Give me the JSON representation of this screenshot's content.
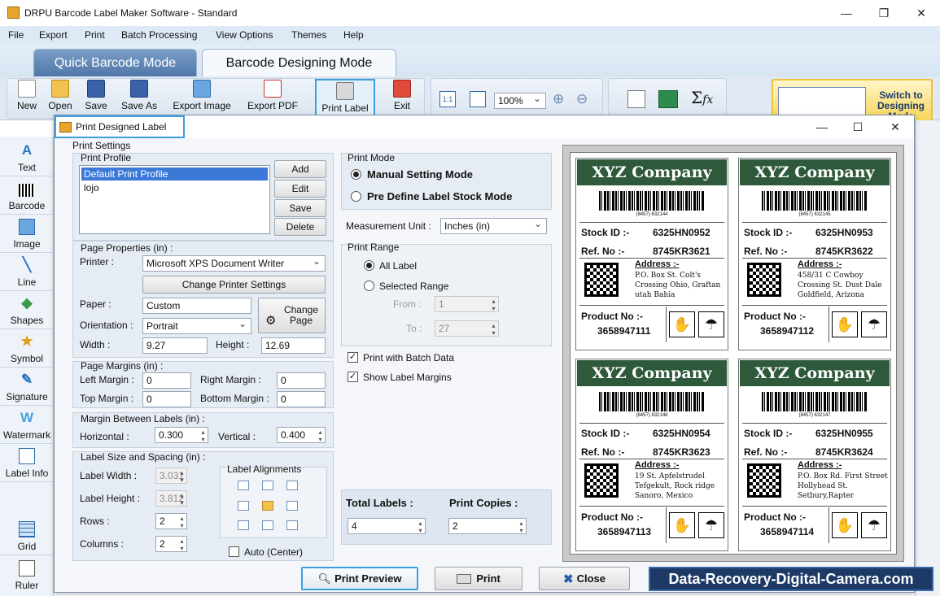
{
  "app": {
    "title": "DRPU Barcode Label Maker Software - Standard"
  },
  "menu": [
    "File",
    "Export",
    "Print",
    "Batch Processing",
    "View Options",
    "Themes",
    "Help"
  ],
  "modes": {
    "quick": "Quick Barcode Mode",
    "designing": "Barcode Designing Mode"
  },
  "toolbar": {
    "new": "New",
    "open": "Open",
    "save": "Save",
    "save_as": "Save As",
    "export_image": "Export Image",
    "export_pdf": "Export PDF",
    "print_label": "Print Label",
    "exit": "Exit",
    "zoom": "100%",
    "switch": "Switch to Designing Mode"
  },
  "leftbar": [
    "Text",
    "Barcode",
    "Image",
    "Line",
    "Shapes",
    "Symbol",
    "Signature",
    "Watermark",
    "Label Info",
    "Grid",
    "Ruler"
  ],
  "dialog": {
    "title": "Print Designed Label",
    "print_settings": "Print Settings",
    "print_profile": {
      "title": "Print Profile",
      "items": [
        "Default Print Profile",
        "lojo"
      ],
      "add": "Add",
      "edit": "Edit",
      "save": "Save",
      "delete": "Delete"
    },
    "page_props": {
      "title": "Page Properties (in) :",
      "printer_label": "Printer :",
      "printer": "Microsoft XPS Document Writer",
      "change_printer": "Change Printer Settings",
      "paper_label": "Paper :",
      "paper": "Custom",
      "orientation_label": "Orientation :",
      "orientation": "Portrait",
      "change_page": "Change Page",
      "width_label": "Width :",
      "width": "9.27",
      "height_label": "Height :",
      "height": "12.69"
    },
    "margins": {
      "title": "Page Margins (in) :",
      "left_label": "Left Margin :",
      "left": "0",
      "right_label": "Right Margin :",
      "right": "0",
      "top_label": "Top Margin :",
      "top": "0",
      "bottom_label": "Bottom Margin :",
      "bottom": "0"
    },
    "between": {
      "title": "Margin Between Labels (in) :",
      "horizontal_label": "Horizontal :",
      "horizontal": "0.300",
      "vertical_label": "Vertical :",
      "vertical": "0.400"
    },
    "size": {
      "title": "Label Size and Spacing (in) :",
      "width_label": "Label Width :",
      "width": "3.031",
      "height_label": "Label Height :",
      "height": "3.812",
      "rows_label": "Rows :",
      "rows": "2",
      "cols_label": "Columns :",
      "cols": "2",
      "alignments": "Label Alignments",
      "auto_center": "Auto (Center)"
    },
    "mode": {
      "title": "Print Mode",
      "manual": "Manual Setting Mode",
      "predefine": "Pre Define Label Stock Mode"
    },
    "unit": {
      "label": "Measurement Unit :",
      "value": "Inches (in)"
    },
    "range": {
      "title": "Print Range",
      "all": "All Label",
      "selected": "Selected Range",
      "from_label": "From :",
      "from": "1",
      "to_label": "To :",
      "to": "27"
    },
    "batch": "Print with Batch Data",
    "show_margins": "Show Label Margins",
    "totals": {
      "total_label": "Total Labels :",
      "total": "4",
      "copies_label": "Print Copies :",
      "copies": "2"
    },
    "buttons": {
      "preview": "Print Preview",
      "print": "Print",
      "close": "Close"
    }
  },
  "labels": [
    {
      "company": "XYZ Company",
      "barcode": "(8457) 632144",
      "stock_label": "Stock ID :-",
      "stock": "6325HN0952",
      "ref_label": "Ref. No :-",
      "ref": "8745KR3621",
      "addr_title": "Address :-",
      "addr": "P.O. Box St. Colt's Crossing Ohio, Graftan utah Bahia",
      "prod_label": "Product No :-",
      "prod": "3658947111"
    },
    {
      "company": "XYZ Company",
      "barcode": "(8457) 632145",
      "stock_label": "Stock ID :-",
      "stock": "6325HN0953",
      "ref_label": "Ref. No :-",
      "ref": "8745KR3622",
      "addr_title": "Address :-",
      "addr": "458/31 C Cowboy Crossing St. Dust Dale Goldfield, Arizona",
      "prod_label": "Product No :-",
      "prod": "3658947112"
    },
    {
      "company": "XYZ Company",
      "barcode": "(8457) 632146",
      "stock_label": "Stock ID :-",
      "stock": "6325HN0954",
      "ref_label": "Ref. No :-",
      "ref": "8745KR3623",
      "addr_title": "Address :-",
      "addr": "19 St. Apfelstrudel Tefgekult, Rock ridge Sanoro, Mexico",
      "prod_label": "Product No :-",
      "prod": "3658947113"
    },
    {
      "company": "XYZ Company",
      "barcode": "(8457) 632147",
      "stock_label": "Stock ID :-",
      "stock": "6325HN0955",
      "ref_label": "Ref. No :-",
      "ref": "8745KR3624",
      "addr_title": "Address :-",
      "addr": "P.O. Box Rd. First Street Hollyhead St. Setbury,Rapter",
      "prod_label": "Product No :-",
      "prod": "3658947114"
    }
  ],
  "watermark": "Data-Recovery-Digital-Camera.com"
}
